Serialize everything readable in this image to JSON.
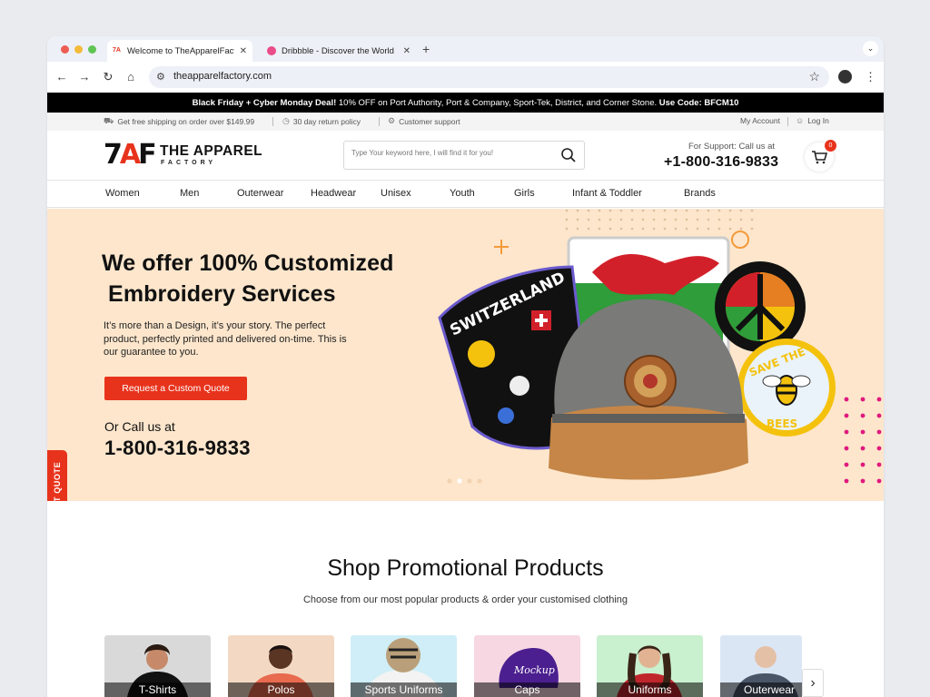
{
  "browser": {
    "tabs": [
      {
        "title": "Welcome to TheApparelFact..",
        "active": true
      },
      {
        "title": "Dribbble - Discover the World",
        "active": false
      }
    ],
    "url": "theapparelfactory.com"
  },
  "promo": {
    "lead": "Black Friday + Cyber Monday Deal!",
    "text": " 10% OFF on Port Authority, Port & Company, Sport-Tek, District, and Corner Stone. ",
    "code": "Use Code: BFCM10"
  },
  "infobar": {
    "shipping": "Get free shipping on order over $149.99",
    "returns": "30 day return policy",
    "support": "Customer support",
    "account": "My Account",
    "login": "Log In"
  },
  "header": {
    "logo_mark": [
      "7",
      "A",
      "F"
    ],
    "logo_name": "THE APPAREL",
    "logo_sub": "FACTORY",
    "search_placeholder": "Type Your keyword here, I will find it for you!",
    "support_label": "For Support: Call us at",
    "support_phone": "+1-800-316-9833",
    "cart_count": "0"
  },
  "nav": [
    "Women",
    "Men",
    "Outerwear",
    "Headwear",
    "Unisex",
    "Youth",
    "Girls",
    "Infant & Toddler",
    "Brands"
  ],
  "hero": {
    "title_line1": "We offer 100% Customized",
    "title_line2": " Embroidery Services",
    "body": "It’s more than a Design, it’s your story. The perfect product, perfectly printed and delivered on-time. This is our guarantee to you.",
    "cta": "Request a Custom Quote",
    "callus": "Or Call us at",
    "phone": "1-800-316-9833",
    "patches": [
      "SWITZERLAND",
      "SAVE THE",
      "BEES"
    ],
    "slide_count": 4,
    "active_slide": 1
  },
  "quote_tab": "GET QUOTE",
  "products": {
    "title": "Shop Promotional Products",
    "subtitle": "Choose from our most popular products & order your customised clothing",
    "items": [
      "T-Shirts",
      "Polos",
      "Sports Uniforms",
      "Caps",
      "Uniforms",
      "Outerwear"
    ],
    "cap_text": "Mockup"
  },
  "colors": {
    "brand_red": "#e8331c",
    "hero_bg": "#fde6cc",
    "promo_bg": "#000000",
    "accent_pink": "#e0197d"
  }
}
